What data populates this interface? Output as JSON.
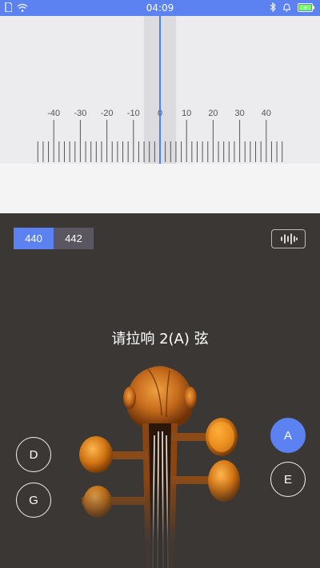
{
  "status_bar": {
    "time": "04:09",
    "icons_left": [
      "sim-card-icon",
      "wifi-icon"
    ],
    "icons_right": [
      "bluetooth-icon",
      "alarm-icon",
      "battery-icon"
    ]
  },
  "meter": {
    "scale_labels": [
      "-40",
      "-30",
      "-20",
      "-10",
      "0",
      "10",
      "20",
      "30",
      "40"
    ],
    "deviation_cents": 0,
    "accent_color": "#4a80ff"
  },
  "reference_pitch": {
    "options": [
      "440",
      "442"
    ],
    "selected": "440"
  },
  "wave_button_icon": "waveform-icon",
  "prompt": "请拉响 2(A) 弦",
  "strings": {
    "left": [
      "D",
      "G"
    ],
    "right": [
      "A",
      "E"
    ],
    "selected": "A"
  },
  "colors": {
    "primary": "#5b82f0",
    "background": "#3a3735"
  }
}
